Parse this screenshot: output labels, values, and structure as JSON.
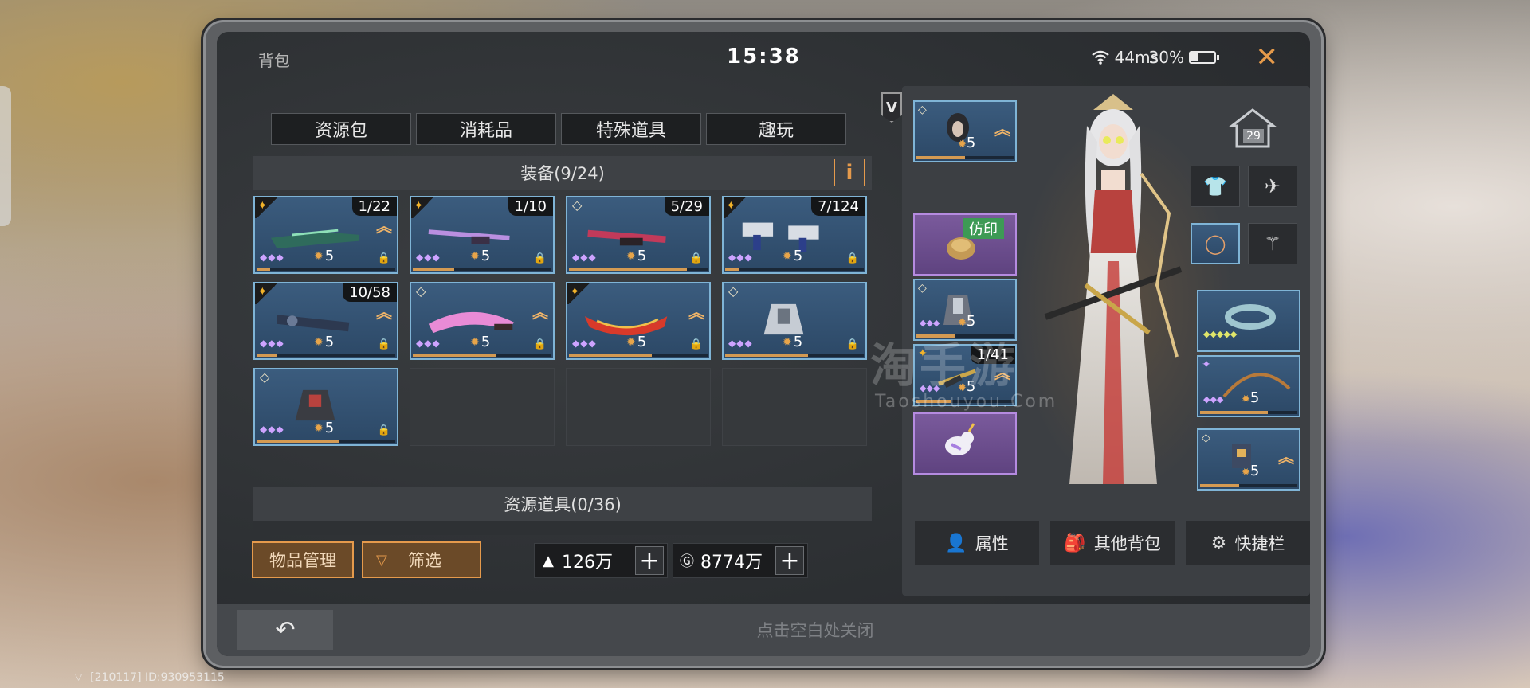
{
  "status": {
    "title": "背包",
    "time": "15:38",
    "ping": "44ms",
    "battery": "30%",
    "battery_level": 0.3
  },
  "tabs": [
    {
      "label": "资源包",
      "active": true
    },
    {
      "label": "消耗品",
      "active": false
    },
    {
      "label": "特殊道具",
      "active": false
    },
    {
      "label": "趣玩",
      "active": false
    }
  ],
  "v_badge": "V",
  "equipment_section": {
    "title": "装备(9/24)",
    "info_label": "i"
  },
  "equipment_items": [
    {
      "qty": "1/22",
      "level": "5",
      "rarity": "flame",
      "upgrade": true,
      "art": "rifle-green",
      "progress": 0.1
    },
    {
      "qty": "1/10",
      "level": "5",
      "rarity": "flame",
      "upgrade": false,
      "art": "rifle-purple",
      "progress": 0.3
    },
    {
      "qty": "5/29",
      "level": "5",
      "rarity": "gem",
      "upgrade": false,
      "art": "rifle-red",
      "progress": 0.85
    },
    {
      "qty": "7/124",
      "level": "5",
      "rarity": "flame",
      "upgrade": false,
      "art": "dual-pistols",
      "progress": 0.1
    },
    {
      "qty": "10/58",
      "level": "5",
      "rarity": "flame",
      "upgrade": true,
      "art": "launcher",
      "progress": 0.15
    },
    {
      "qty": "",
      "level": "5",
      "rarity": "gem",
      "upgrade": true,
      "art": "pink-blade",
      "progress": 0.6
    },
    {
      "qty": "",
      "level": "5",
      "rarity": "flame",
      "upgrade": true,
      "art": "red-blade",
      "progress": 0.6
    },
    {
      "qty": "",
      "level": "5",
      "rarity": "gem",
      "upgrade": false,
      "art": "silver-armor",
      "progress": 0.6
    },
    {
      "qty": "",
      "level": "5",
      "rarity": "gem",
      "upgrade": false,
      "art": "red-armor",
      "progress": 0.6
    }
  ],
  "resource_section": {
    "title": "资源道具(0/36)"
  },
  "bottom_left": {
    "manage_label": "物品管理",
    "filter_label": "筛选"
  },
  "currencies": [
    {
      "icon": "gold-bar-icon",
      "value": "126万"
    },
    {
      "icon": "coin-icon",
      "value": "8774万"
    }
  ],
  "equipped": {
    "head": {
      "level": "5"
    },
    "imprint": {
      "tag": "仿印"
    },
    "armor": {
      "level": "5"
    },
    "weapon": {
      "qty": "1/41",
      "level": "5"
    },
    "pet": {},
    "ring_large": {},
    "bow": {
      "level": "5"
    },
    "mech": {
      "level": "5"
    }
  },
  "home": {
    "level": "29"
  },
  "right_buttons": [
    {
      "label": "属性",
      "icon": "person-icon"
    },
    {
      "label": "其他背包",
      "icon": "bag-icon"
    },
    {
      "label": "快捷栏",
      "icon": "shortcut-icon"
    }
  ],
  "footer": {
    "hint": "点击空白处关闭"
  },
  "watermark": {
    "main": "淘手游",
    "sub": "Taoshouyou.Com"
  },
  "system_id": "[210117] ID:930953115"
}
